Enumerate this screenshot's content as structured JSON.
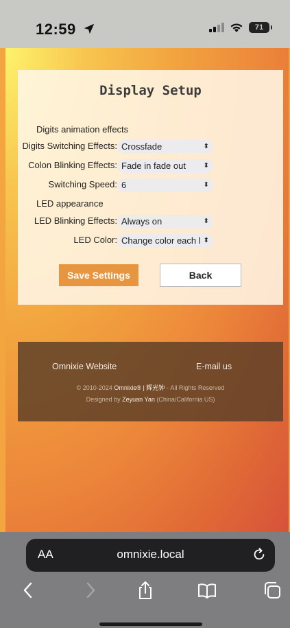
{
  "status_bar": {
    "time": "12:59",
    "battery": "71"
  },
  "card": {
    "title": "Display Setup",
    "section_digits": "Digits animation effects",
    "digits_switching_label": "Digits Switching Effects:",
    "digits_switching_value": "Crossfade",
    "colon_blinking_label": "Colon Blinking Effects:",
    "colon_blinking_value": "Fade in fade out",
    "switching_speed_label": "Switching Speed:",
    "switching_speed_value": "6",
    "section_led": "LED appearance",
    "led_blinking_label": "LED Blinking Effects:",
    "led_blinking_value": "Always on",
    "led_color_label": "LED Color:",
    "led_color_value": "Change color each l",
    "save_label": "Save Settings",
    "back_label": "Back"
  },
  "footer": {
    "website_link": "Omnixie Website",
    "email_link": "E-mail us",
    "copyright_prefix": "© 2010-2024",
    "brand": "Omnixie® | 辉光钟",
    "rights": "- All Rights Reserved",
    "designed_by": "Designed by",
    "designer": "Zeyuan Yan",
    "designer_location": "(China/California US)"
  },
  "browser": {
    "text_size_label": "AA",
    "url": "omnixie.local"
  },
  "colors": {
    "save_button": "#e8953f",
    "footer_bg": "#5f4128",
    "page_gradient_start": "#fdf36b",
    "page_gradient_end": "#d6523a"
  },
  "icons": {
    "status": [
      "location-arrow-icon",
      "signal-icon",
      "wifi-icon",
      "battery-icon"
    ],
    "toolbar": [
      "back-icon",
      "forward-icon",
      "share-icon",
      "bookmarks-icon",
      "tabs-icon"
    ],
    "urlbar": [
      "reload-icon"
    ]
  }
}
